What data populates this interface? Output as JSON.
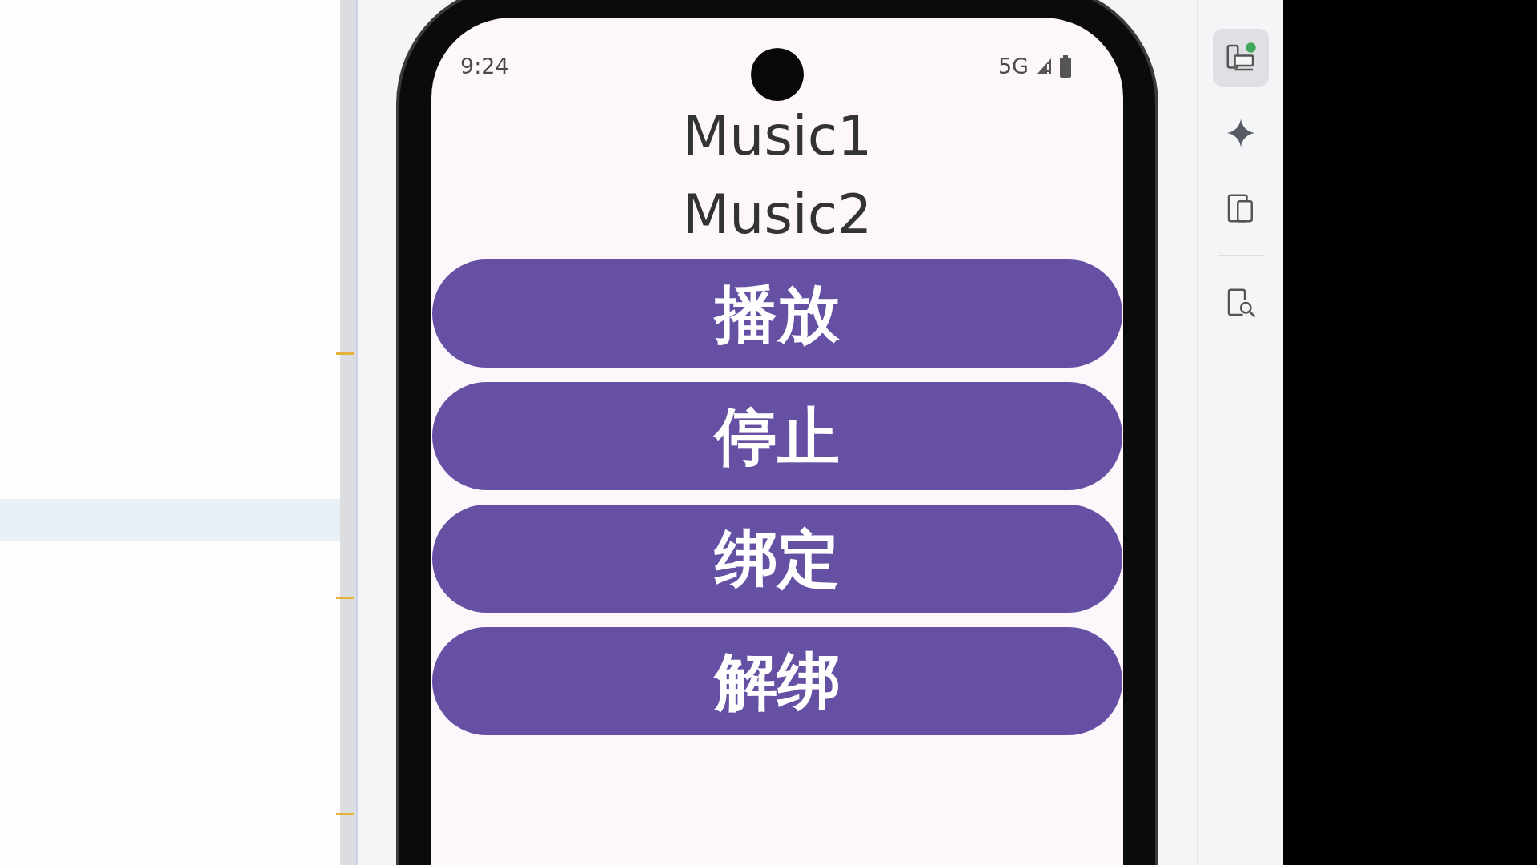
{
  "status_bar": {
    "time": "9:24",
    "network": "5G"
  },
  "texts": [
    "Music1",
    "Music2"
  ],
  "buttons": [
    "播放",
    "停止",
    "绑定",
    "解绑"
  ],
  "toolbar": [
    {
      "kind": "running-devices",
      "selected": true
    },
    {
      "kind": "sparkle",
      "selected": false
    },
    {
      "kind": "device-mirror",
      "selected": false
    },
    {
      "kind": "divider"
    },
    {
      "kind": "device-inspect",
      "selected": false
    }
  ]
}
